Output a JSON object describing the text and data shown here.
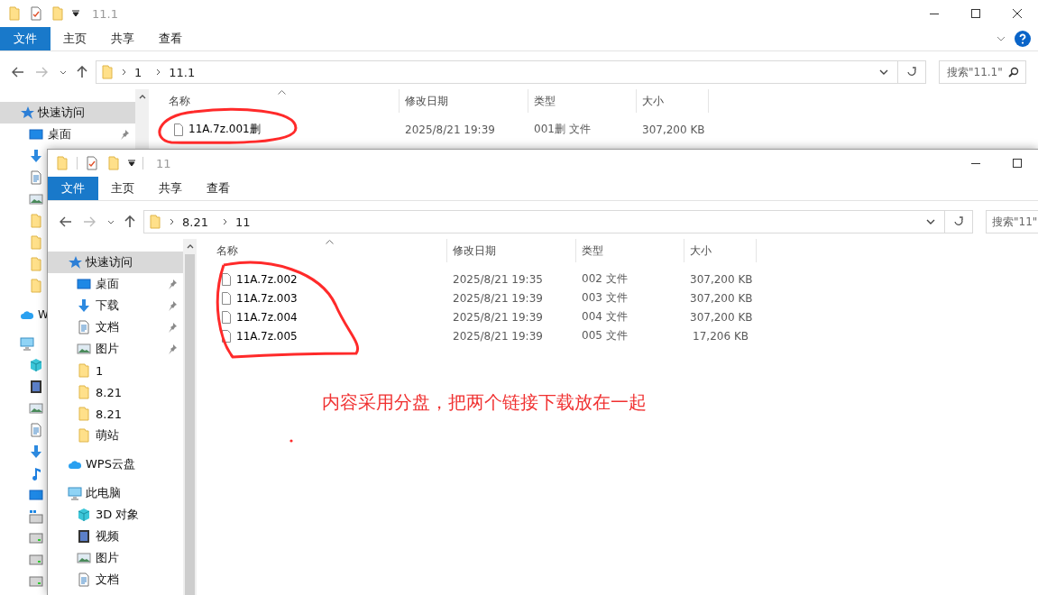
{
  "back_window": {
    "title": "11.1",
    "help_button": true,
    "ribbon_tabs": [
      {
        "label": "文件",
        "selected": true
      },
      {
        "label": "主页",
        "selected": false
      },
      {
        "label": "共享",
        "selected": false
      },
      {
        "label": "查看",
        "selected": false
      }
    ],
    "path": [
      "1",
      "11.1"
    ],
    "search": {
      "placeholder": "搜索\"11.1\""
    },
    "nav": [
      {
        "label": "快速访问",
        "kind": "star",
        "selected": true,
        "pinned": false,
        "children": [
          {
            "label": "桌面",
            "kind": "desktop",
            "selected": false,
            "pinned": true
          },
          {
            "kind": "download"
          },
          {
            "kind": "document"
          },
          {
            "kind": "picture"
          },
          {
            "kind": "folder"
          },
          {
            "kind": "folder"
          },
          {
            "kind": "folder"
          },
          {
            "kind": "folder"
          }
        ]
      },
      {
        "label": "W",
        "kind": "cloud"
      },
      {
        "kind": "computer",
        "children": [
          {
            "kind": "cube"
          },
          {
            "kind": "video"
          },
          {
            "kind": "picture"
          },
          {
            "kind": "document"
          },
          {
            "kind": "download"
          },
          {
            "kind": "music"
          },
          {
            "kind": "desktop"
          },
          {
            "kind": "system-drive"
          },
          {
            "kind": "drive"
          },
          {
            "kind": "drive"
          },
          {
            "kind": "drive"
          }
        ]
      }
    ],
    "columns": [
      "名称",
      "修改日期",
      "类型",
      "大小"
    ],
    "rows": [
      {
        "name": "11A.7z.001删",
        "modified": "2025/8/21 19:39",
        "type": "001删 文件",
        "size": "307,200 KB"
      }
    ]
  },
  "front_window": {
    "title": "11",
    "ribbon_tabs": [
      {
        "label": "文件",
        "selected": true
      },
      {
        "label": "主页",
        "selected": false
      },
      {
        "label": "共享",
        "selected": false
      },
      {
        "label": "查看",
        "selected": false
      }
    ],
    "path": [
      "8.21",
      "11"
    ],
    "search": {
      "placeholder": "搜索\"11\""
    },
    "nav": [
      {
        "label": "快速访问",
        "kind": "star",
        "selected": true,
        "pinned": false,
        "children": [
          {
            "label": "桌面",
            "kind": "desktop",
            "selected": false,
            "pinned": true
          },
          {
            "label": "下载",
            "kind": "download",
            "selected": false,
            "pinned": true
          },
          {
            "label": "文档",
            "kind": "document",
            "selected": false,
            "pinned": true
          },
          {
            "label": "图片",
            "kind": "picture",
            "selected": false,
            "pinned": true
          },
          {
            "label": "1",
            "kind": "folder",
            "selected": false,
            "pinned": false
          },
          {
            "label": "8.21",
            "kind": "folder",
            "selected": false,
            "pinned": false
          },
          {
            "label": "8.21",
            "kind": "folder",
            "selected": false,
            "pinned": false
          },
          {
            "label": "萌站",
            "kind": "folder",
            "selected": false,
            "pinned": false
          }
        ]
      },
      {
        "label": "WPS云盘",
        "kind": "cloud",
        "selected": false,
        "pinned": false
      },
      {
        "label": "此电脑",
        "kind": "computer",
        "selected": false,
        "pinned": false,
        "children": [
          {
            "label": "3D 对象",
            "kind": "cube",
            "selected": false,
            "pinned": false
          },
          {
            "label": "视频",
            "kind": "video",
            "selected": false,
            "pinned": false
          },
          {
            "label": "图片",
            "kind": "picture",
            "selected": false,
            "pinned": false
          },
          {
            "label": "文档",
            "kind": "document",
            "selected": false,
            "pinned": false
          }
        ]
      }
    ],
    "columns": [
      "名称",
      "修改日期",
      "类型",
      "大小"
    ],
    "rows": [
      {
        "name": "11A.7z.002",
        "modified": "2025/8/21 19:35",
        "type": "002 文件",
        "size": "307,200 KB"
      },
      {
        "name": "11A.7z.003",
        "modified": "2025/8/21 19:39",
        "type": "003 文件",
        "size": "307,200 KB"
      },
      {
        "name": "11A.7z.004",
        "modified": "2025/8/21 19:39",
        "type": "004 文件",
        "size": "307,200 KB"
      },
      {
        "name": "11A.7z.005",
        "modified": "2025/8/21 19:39",
        "type": "005 文件",
        "size": "17,206 KB"
      }
    ]
  },
  "annotation": {
    "note": "内容采用分盘，把两个链接下载放在一起"
  }
}
